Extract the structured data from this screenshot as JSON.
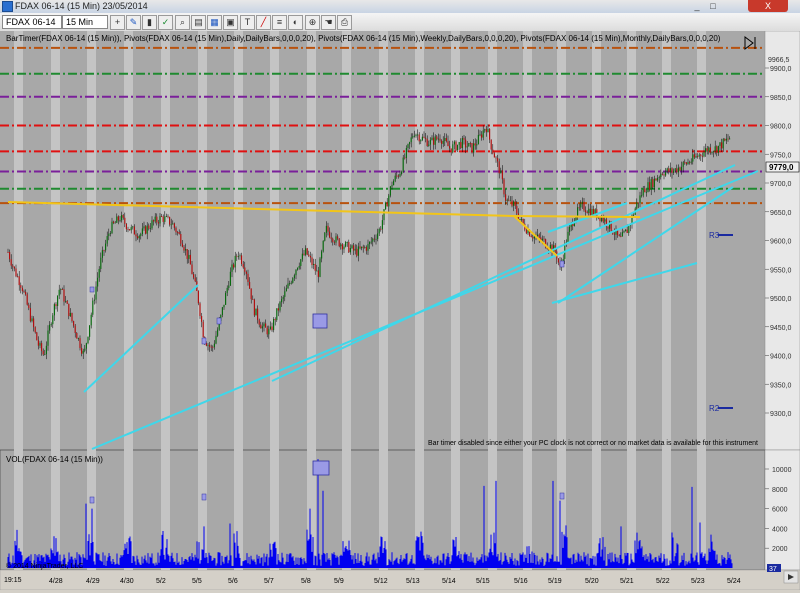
{
  "window": {
    "title": "FDAX 06-14 (15 Min)  23/05/2014",
    "close_label": "X",
    "minimize_label": "_",
    "maximize_label": "□"
  },
  "toolbar": {
    "instrument": "FDAX 06-14",
    "interval": "15 Min",
    "icons": [
      "crosshair-icon",
      "pencil-icon",
      "bars-icon",
      "chart-style-icon",
      "magnify-icon",
      "properties-icon",
      "indicators-icon",
      "strategy-icon",
      "text-icon",
      "line-icon",
      "fib-icon",
      "color-icon",
      "zoom-icon",
      "hand-icon",
      "print-icon"
    ]
  },
  "chart": {
    "indicator_header": "BarTimer(FDAX 06-14 (15 Min)), Pivots(FDAX 06-14 (15 Min),Daily,DailyBars,0,0,0,20), Pivots(FDAX 06-14 (15 Min),Weekly,DailyBars,0,0,0,20), Pivots(FDAX 06-14 (15 Min),Monthly,DailyBars,0,0,0,20)",
    "price_high_label": "9966,5",
    "price_labels": [
      "9900,0",
      "9850,0",
      "9800,0",
      "9750,0",
      "9700,0",
      "9650,0",
      "9600,0",
      "9550,0",
      "9500,0",
      "9450,0",
      "9400,0",
      "9350,0",
      "9300,0"
    ],
    "current_price": "9779,0",
    "pivot_labels": {
      "r3": "R3",
      "r2": "R2"
    },
    "bartimer_message": "Bar timer disabled since either your PC clock is not correct or no market data is available for this instrument",
    "volume_header": "VOL(FDAX 06-14 (15 Min))",
    "volume_labels": [
      "10000",
      "8000",
      "6000",
      "4000",
      "2000"
    ],
    "volume_current": "37",
    "copyright": "© 2014 NinjaTrader, LLC",
    "time_start": "19:15",
    "dates": [
      "4/28",
      "4/29",
      "4/30",
      "5/2",
      "5/5",
      "5/6",
      "5/7",
      "5/8",
      "5/9",
      "5/12",
      "5/13",
      "5/14",
      "5/15",
      "5/16",
      "5/19",
      "5/20",
      "5/21",
      "5/22",
      "5/23",
      "5/24"
    ],
    "colors": {
      "background": "#a8a8a8",
      "session_band": "#c4c4c4",
      "trendline": "#3fd7ea",
      "yellow_line": "#f2c518",
      "volume": "#0000f0",
      "pivot_orange": "#b8520e",
      "pivot_green": "#1f8a30",
      "pivot_purple": "#7a1f9a",
      "pivot_red": "#e01010"
    }
  },
  "chart_data": {
    "type": "candlestick",
    "x": [
      "4/28",
      "4/29",
      "4/30",
      "5/2",
      "5/5",
      "5/6",
      "5/7",
      "5/8",
      "5/9",
      "5/12",
      "5/13",
      "5/14",
      "5/15",
      "5/16",
      "5/19",
      "5/20",
      "5/21",
      "5/22",
      "5/23"
    ],
    "close": [
      9400,
      9520,
      9620,
      9590,
      9450,
      9520,
      9440,
      9540,
      9590,
      9670,
      9790,
      9770,
      9750,
      9620,
      9570,
      9650,
      9620,
      9720,
      9779
    ],
    "ylim": [
      9280,
      9966.5
    ],
    "pivot_levels": [
      9935,
      9890,
      9850,
      9800,
      9755,
      9720,
      9690,
      9665
    ],
    "volume_ylim": [
      0,
      11000
    ],
    "last_price": 9779.0,
    "last_volume": 37
  }
}
